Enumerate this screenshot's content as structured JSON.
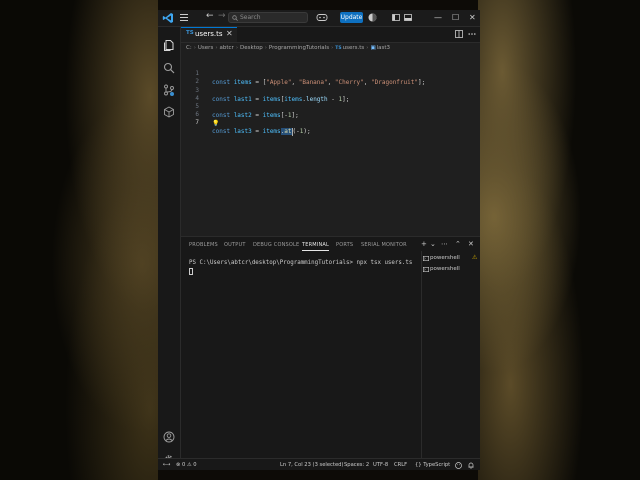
{
  "titlebar": {
    "search_placeholder": "Search",
    "update_label": "Update",
    "window_controls": [
      "—",
      "☐",
      "✕"
    ]
  },
  "tab": {
    "badge": "TS",
    "name": "users.ts",
    "close": "✕"
  },
  "breadcrumb": [
    "C:",
    "Users",
    "abtcr",
    "Desktop",
    "ProgrammingTutorials",
    "users.ts",
    "last3"
  ],
  "editor": {
    "lines": [
      {
        "n": "1",
        "kw": "const ",
        "name": "items",
        "rest": " = [",
        "strs": [
          "\"Apple\"",
          "\"Banana\"",
          "\"Cherry\"",
          "\"Dragonfruit\""
        ],
        "end": "];"
      },
      {
        "n": "2"
      },
      {
        "n": "3",
        "kw": "const ",
        "name": "last1",
        "a": " = ",
        "b": "items",
        "c": "[",
        "d": "items",
        "e": ".",
        "f": "length",
        "g": " - ",
        "h": "1",
        "i": "];"
      },
      {
        "n": "4"
      },
      {
        "n": "5",
        "kw": "const ",
        "name": "last2",
        "a": " = ",
        "b": "items",
        "c": "[-",
        "h": "1",
        "i": "];"
      },
      {
        "n": "6"
      },
      {
        "n": "7",
        "kw": "const ",
        "name": "last3",
        "a": " = ",
        "b": "items",
        "dot": ".",
        "fn": "at",
        "c": "(-",
        "h": "1",
        "i": ");"
      }
    ],
    "lightbulb": "💡"
  },
  "panel": {
    "tabs": [
      "PROBLEMS",
      "OUTPUT",
      "DEBUG CONSOLE",
      "TERMINAL",
      "PORTS",
      "SERIAL MONITOR"
    ],
    "active_tab": "TERMINAL",
    "tools": [
      "+",
      "⌄",
      "⋯",
      "⌃",
      "✕"
    ],
    "terminal_prompt": "PS C:\\Users\\abtcr\\desktop\\ProgrammingTutorials> npx tsx users.ts",
    "terminals": [
      "powershell",
      "powershell"
    ],
    "warning_glyph": "⚠"
  },
  "status": {
    "errors": "⊗ 0 ⚠ 0",
    "remote_glyph": "⟷",
    "position": "Ln 7, Col 23 (3 selected)",
    "spaces": "Spaces: 2",
    "encoding": "UTF-8",
    "eol": "CRLF",
    "language": "{} TypeScript"
  },
  "colors": {
    "accent": "#0078d4",
    "update_button": "#0e70c0",
    "keyword": "#569cd6",
    "variable": "#4fc1ff",
    "string": "#ce9178",
    "number": "#b5cea8",
    "function": "#dcdcaa",
    "selection": "#264f78"
  }
}
